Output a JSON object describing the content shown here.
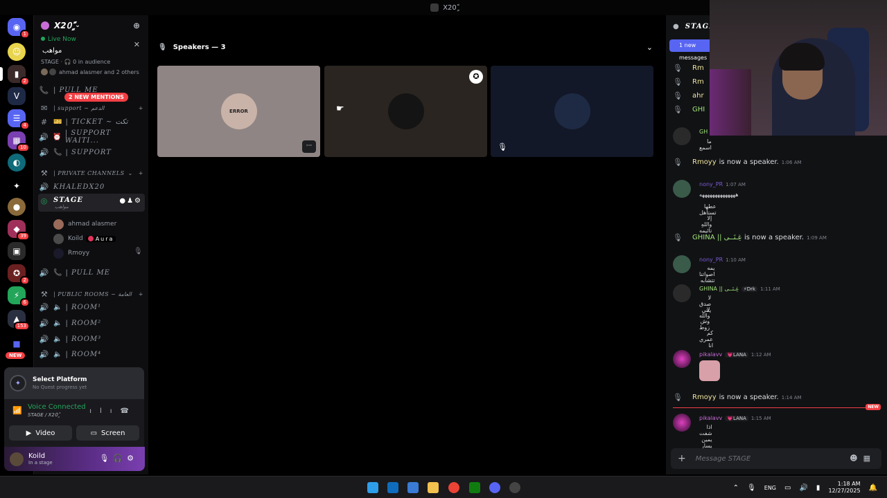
{
  "window": {
    "title": "X20ًٍ"
  },
  "server": {
    "name": "X20ًٍ"
  },
  "live": {
    "status": "Live Now",
    "name": "مواهب",
    "audience": "STAGE · 🎧 0 in audience",
    "people": "ahmad alasmer and 2 others",
    "close": "✕"
  },
  "mentions": "2 NEW MENTIONS",
  "rail": {
    "badges": [
      "1",
      "2",
      "4",
      "10",
      "39",
      "2",
      "6",
      "153"
    ],
    "new": "NEW"
  },
  "channels": {
    "pull_top": "| PULL ME",
    "support_cat": "| support ~ الدعم",
    "ticket": "| TICKET ~ تكت",
    "support_waiting": "| SUPPORT WAITI...",
    "support": "| SUPPORT",
    "private_cat": "| PRIVATE CHANNELS",
    "khaled": "KHALEDX20",
    "stage": "STAGE",
    "stage_sub": "مواهب",
    "pull_me": "| PULL ME",
    "public_cat": "| PUBLIC ROOMS ~ العامة",
    "rooms": [
      "| ROOM¹",
      "| ROOM²",
      "| ROOM³",
      "| ROOM⁴"
    ]
  },
  "members": [
    {
      "name": "ahmad alasmer"
    },
    {
      "name": "Koild",
      "tag": "Aura"
    },
    {
      "name": "Rmoyy"
    }
  ],
  "quest": {
    "title": "Select Platform",
    "sub": "No Quest progress yet"
  },
  "voice": {
    "status": "Voice Connected",
    "channel": "STAGE / X20ًٍ",
    "video": "Video",
    "screen": "Screen"
  },
  "user": {
    "name": "Koild",
    "status": "In a stage"
  },
  "stage": {
    "header": "Speakers — 3",
    "tile1_label": "ERROR",
    "more": "···"
  },
  "chat": {
    "channel": "STAGE",
    "new_messages": "1 new messages",
    "placeholder": "Message STAGE",
    "new_tag": "NEW",
    "peek": [
      {
        "name": "Rm",
        "color": "#f0e6a0"
      },
      {
        "name": "Rm",
        "color": "#f0e6a0"
      },
      {
        "name": "ahr",
        "color": "#f0e6a0"
      },
      {
        "name": "GHI",
        "color": "#a0e37a"
      },
      {
        "name": "GH",
        "color": "#a0e37a"
      }
    ],
    "peek_text": "ما اسمع",
    "events": [
      {
        "name": "Rmoyy",
        "text": "is now a speaker.",
        "time": "1:06 AM",
        "color": "#f0e6a0"
      },
      {
        "name": "GHINA || غِـنَــى",
        "text": "is now a speaker.",
        "time": "1:09 AM",
        "color": "#a0e37a"
      },
      {
        "name": "Rmoyy",
        "text": "is now a speaker.",
        "time": "1:14 AM",
        "color": "#f0e6a0"
      }
    ],
    "messages": [
      {
        "name": "nony_PR",
        "time": "1:07 AM",
        "color": "#7c5cd6",
        "lines": [
          "ههههههههههههههه",
          "عطها تستأهل",
          "إلا واللهِ تائيمه"
        ]
      },
      {
        "name": "nony_PR",
        "time": "1:10 AM",
        "color": "#7c5cd6",
        "lines": [
          "يمه اصواتنا تتشابه"
        ]
      },
      {
        "name": "GHINA || غِـنَــى",
        "time": "1:11 AM",
        "tag": "⚡Drk",
        "color": "#a0e37a",
        "lines": [
          "لا صدق ينتي",
          "لا والله",
          "وش زوط",
          "كم عمري انا"
        ]
      },
      {
        "name": "pikalavv",
        "time": "1:12 AM",
        "tag": "💗LANA",
        "color": "#c66bd8",
        "lines": []
      },
      {
        "name": "pikalavv",
        "time": "1:15 AM",
        "tag": "💗LANA",
        "color": "#c66bd8",
        "lines": [
          "اذا شفت يمين يسار"
        ]
      }
    ]
  },
  "tray": {
    "lang": "ENG",
    "time": "1:18 AM",
    "date": "12/27/2025"
  },
  "colors": {
    "accent": "#5865f2",
    "online": "#23a55a",
    "danger": "#f23f43"
  }
}
